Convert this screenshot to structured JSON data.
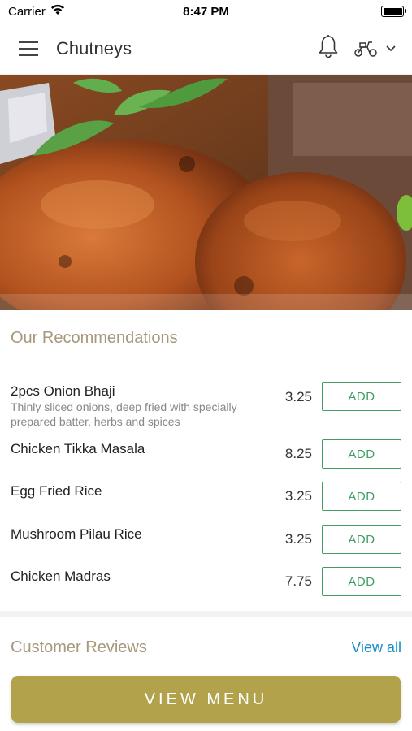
{
  "status_bar": {
    "carrier": "Carrier",
    "time": "8:47 PM"
  },
  "header": {
    "title": "Chutneys"
  },
  "recommendations": {
    "heading": "Our Recommendations",
    "items": [
      {
        "name": "2pcs Onion Bhaji",
        "description": "Thinly sliced onions, deep fried with specially prepared batter, herbs and spices",
        "price": "3.25",
        "button": "ADD"
      },
      {
        "name": "Chicken Tikka Masala",
        "description": "",
        "price": "8.25",
        "button": "ADD"
      },
      {
        "name": "Egg Fried Rice",
        "description": "",
        "price": "3.25",
        "button": "ADD"
      },
      {
        "name": "Mushroom Pilau Rice",
        "description": "",
        "price": "3.25",
        "button": "ADD"
      },
      {
        "name": "Chicken Madras",
        "description": "",
        "price": "7.75",
        "button": "ADD"
      }
    ]
  },
  "reviews": {
    "heading": "Customer Reviews",
    "view_all": "View all"
  },
  "footer": {
    "button": "VIEW MENU"
  },
  "colors": {
    "accent_gold": "#b2a24c",
    "heading": "#a7977b",
    "add_green": "#3f9e64",
    "link_blue": "#1a8fc7"
  }
}
